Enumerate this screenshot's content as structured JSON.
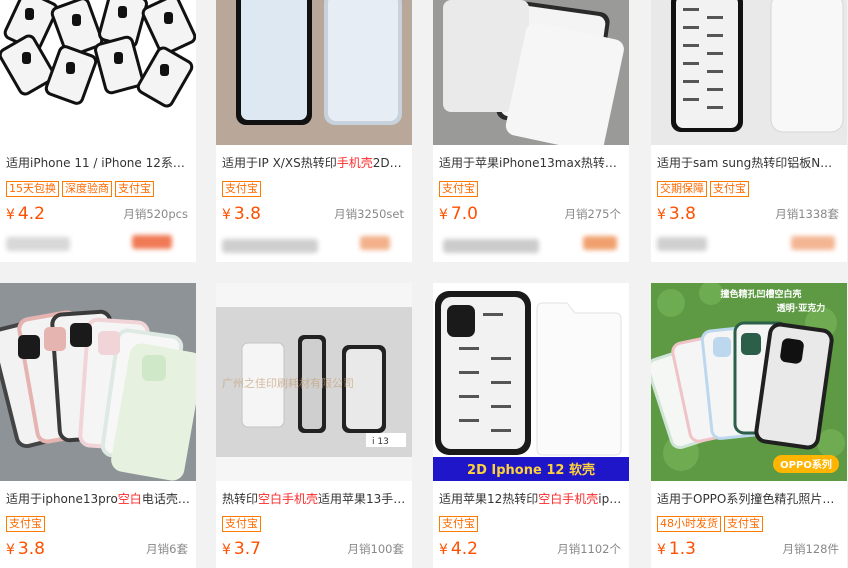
{
  "products": [
    {
      "title_plain": "适用iPhone 11 / iPhone 12系…",
      "title_hl": "",
      "title_tail": "",
      "tags": [
        "15天包换",
        "深度验商",
        "支付宝"
      ],
      "price": "4.2",
      "currency": "¥",
      "sales": "月销520pcs"
    },
    {
      "title_plain": "适用于IP X/XS热转印",
      "title_hl": "手机壳",
      "title_tail": "2D…",
      "tags": [
        "支付宝"
      ],
      "price": "3.8",
      "currency": "¥",
      "sales": "月销3250set"
    },
    {
      "title_plain": "适用于苹果iPhone13max热转…",
      "title_hl": "",
      "title_tail": "",
      "tags": [
        "支付宝"
      ],
      "price": "7.0",
      "currency": "¥",
      "sales": "月销275个"
    },
    {
      "title_plain": "适用于sam sung热转印铝板N…",
      "title_hl": "",
      "title_tail": "",
      "tags": [
        "交期保障",
        "支付宝"
      ],
      "price": "3.8",
      "currency": "¥",
      "sales": "月销1338套"
    },
    {
      "title_plain": "适用于iphone13pro",
      "title_hl": "空白",
      "title_tail": "电话壳…",
      "tags": [
        "支付宝"
      ],
      "price": "3.8",
      "currency": "¥",
      "sales": "月销6套"
    },
    {
      "title_plain": "热转印",
      "title_hl": "空白手机壳",
      "title_tail": "适用苹果13手…",
      "tags": [
        "支付宝"
      ],
      "price": "3.7",
      "currency": "¥",
      "sales": "月销100套"
    },
    {
      "title_plain": "适用苹果12热转印",
      "title_hl": "空白手机壳",
      "title_tail": "ip…",
      "tags": [
        "支付宝"
      ],
      "price": "4.2",
      "currency": "¥",
      "sales": "月销1102个"
    },
    {
      "title_plain": "适用于OPPO系列撞色精孔照片…",
      "title_hl": "",
      "title_tail": "",
      "tags": [
        "48小时发货",
        "支付宝"
      ],
      "price": "1.3",
      "currency": "¥",
      "sales": "月销128件"
    }
  ],
  "image_text": {
    "watermark_5": "广州之佳印刷耗材有限公司",
    "label_5": "i 13",
    "banner_6": "2D  Iphone 12  软壳",
    "overlay_7_top": "撞色精孔凹槽空白壳",
    "overlay_7_sub": "透明·亚克力",
    "overlay_7_badge": "OPPO系列"
  },
  "colors": {
    "accent": "#ff5000",
    "tag_border": "#ff7a00",
    "highlight": "#ff2a2a"
  }
}
